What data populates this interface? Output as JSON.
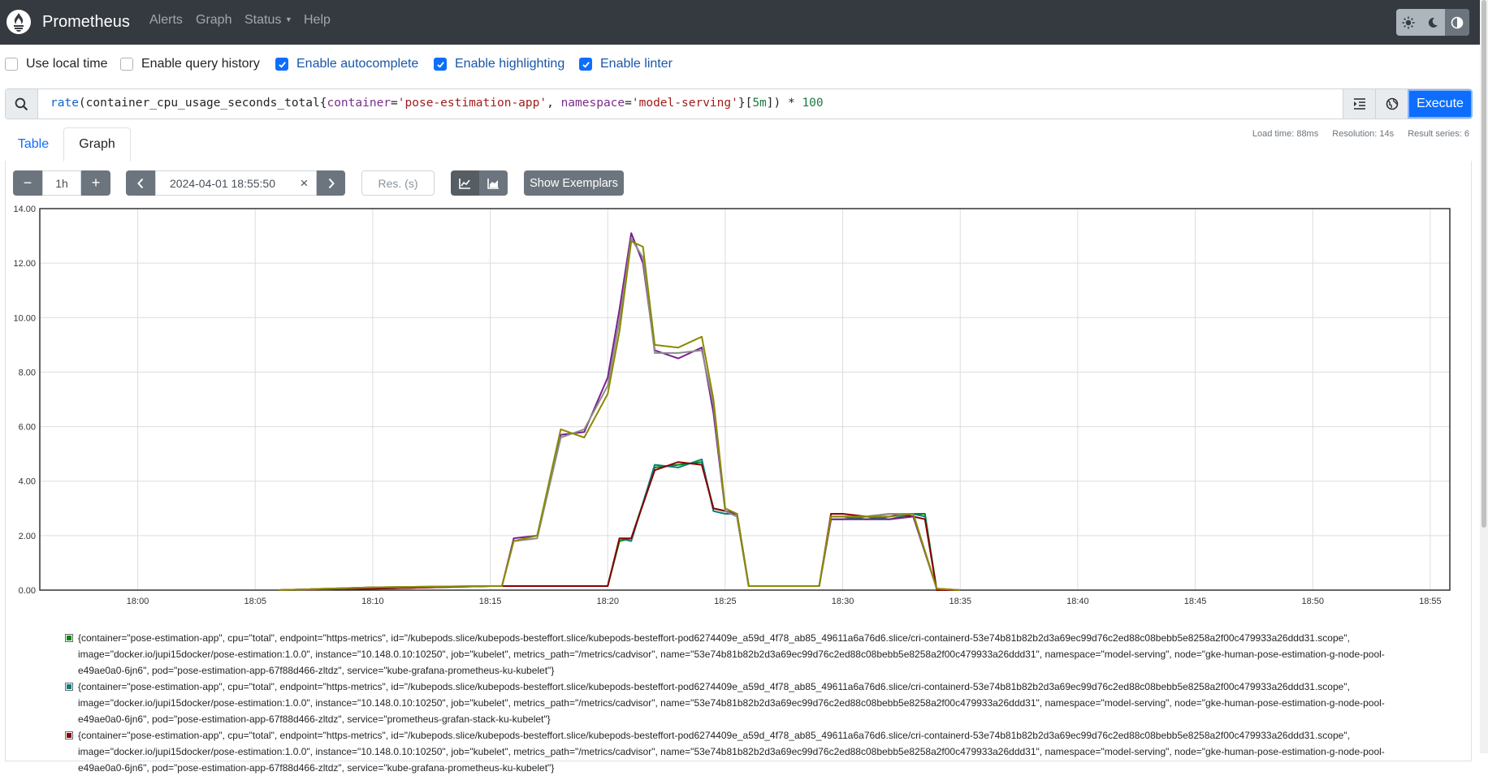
{
  "navbar": {
    "brand": "Prometheus",
    "links": [
      "Alerts",
      "Graph",
      "Status",
      "Help"
    ]
  },
  "options": {
    "local_time": "Use local time",
    "query_history": "Enable query history",
    "autocomplete": "Enable autocomplete",
    "highlighting": "Enable highlighting",
    "linter": "Enable linter",
    "checked": {
      "local_time": false,
      "query_history": false,
      "autocomplete": true,
      "highlighting": true,
      "linter": true
    }
  },
  "query": {
    "fn": "rate",
    "metric": "(container_cpu_usage_seconds_total{",
    "l1": "container",
    "v1": "'pose-estimation-app'",
    "sep": ", ",
    "l2": "namespace",
    "v2": "'model-serving'",
    "range_open": "}[",
    "range": "5m",
    "range_close": "]) * ",
    "mult": "100",
    "execute_label": "Execute"
  },
  "tabs": [
    "Table",
    "Graph"
  ],
  "stats": {
    "load": "Load time: 88ms",
    "resolution": "Resolution: 14s",
    "series": "Result series: 6"
  },
  "controls": {
    "minus": "−",
    "plus": "+",
    "range": "1h",
    "end_time": "2024-04-01 18:55:50",
    "clear": "×",
    "prev": "‹",
    "next": "›",
    "resolution_placeholder": "Res. (s)",
    "exemplars_label": "Show Exemplars"
  },
  "colors": {
    "navbar": "#343a40",
    "accent": "#0d6efd"
  },
  "chart_data": {
    "type": "line",
    "ylim": [
      0,
      14
    ],
    "xlim": [
      "17:55:50",
      "18:55:50"
    ],
    "yticks": [
      "0.00",
      "2.00",
      "4.00",
      "6.00",
      "8.00",
      "10.00",
      "12.00",
      "14.00"
    ],
    "xticks": [
      "18:00",
      "18:05",
      "18:10",
      "18:15",
      "18:20",
      "18:25",
      "18:30",
      "18:35",
      "18:40",
      "18:45",
      "18:50",
      "18:55"
    ],
    "grid": true,
    "legend_position": "bottom",
    "series": [
      {
        "color": "#00890c",
        "x": [
          "18:06",
          "18:10",
          "18:15",
          "18:16",
          "18:17",
          "18:18",
          "18:19",
          "18:20",
          "18:20:30",
          "18:21",
          "18:22",
          "18:23",
          "18:24",
          "18:24:30",
          "18:25",
          "18:25:30",
          "18:26",
          "18:28",
          "18:29",
          "18:29:30",
          "18:30",
          "18:31",
          "18:32",
          "18:33",
          "18:33:30",
          "18:34",
          "18:35"
        ],
        "y": [
          0,
          0.05,
          0.15,
          0.15,
          0.15,
          0.15,
          0.15,
          0.15,
          1.8,
          1.9,
          4.5,
          4.6,
          4.7,
          3.0,
          2.9,
          2.8,
          0.15,
          0.15,
          0.15,
          2.7,
          2.7,
          2.6,
          2.7,
          2.8,
          2.8,
          0,
          0
        ]
      },
      {
        "color": "#0d7d7d",
        "x": [
          "18:06",
          "18:10",
          "18:15",
          "18:16",
          "18:17",
          "18:18",
          "18:19",
          "18:20",
          "18:20:30",
          "18:21",
          "18:22",
          "18:23",
          "18:24",
          "18:24:30",
          "18:25",
          "18:25:30",
          "18:26",
          "18:28",
          "18:29",
          "18:29:30",
          "18:30",
          "18:31",
          "18:32",
          "18:33",
          "18:33:30",
          "18:34",
          "18:35"
        ],
        "y": [
          0,
          0.05,
          0.15,
          0.15,
          0.15,
          0.15,
          0.15,
          0.15,
          1.9,
          1.8,
          4.6,
          4.5,
          4.8,
          2.9,
          2.8,
          2.8,
          0.15,
          0.15,
          0.15,
          2.6,
          2.6,
          2.7,
          2.6,
          2.8,
          2.7,
          0,
          0
        ]
      },
      {
        "color": "#8b0000",
        "x": [
          "18:06",
          "18:10",
          "18:15",
          "18:16",
          "18:17",
          "18:18",
          "18:19",
          "18:20",
          "18:20:30",
          "18:21",
          "18:22",
          "18:23",
          "18:24",
          "18:24:30",
          "18:25",
          "18:25:30",
          "18:26",
          "18:28",
          "18:29",
          "18:29:30",
          "18:30",
          "18:31",
          "18:32",
          "18:33",
          "18:33:30",
          "18:34",
          "18:35"
        ],
        "y": [
          0,
          0.05,
          0.15,
          0.15,
          0.15,
          0.15,
          0.15,
          0.15,
          1.9,
          1.9,
          4.4,
          4.7,
          4.6,
          3.0,
          2.9,
          2.7,
          0.15,
          0.15,
          0.15,
          2.8,
          2.8,
          2.7,
          2.8,
          2.7,
          2.6,
          0,
          0
        ]
      },
      {
        "color": "#7a1e8e",
        "x": [
          "18:06",
          "18:10",
          "18:15",
          "18:15:30",
          "18:16",
          "18:17",
          "18:18",
          "18:19",
          "18:20",
          "18:20:30",
          "18:21",
          "18:21:30",
          "18:22",
          "18:23",
          "18:24",
          "18:24:30",
          "18:25",
          "18:25:30",
          "18:26",
          "18:28",
          "18:29",
          "18:29:30",
          "18:30",
          "18:31",
          "18:32",
          "18:33",
          "18:34",
          "18:35"
        ],
        "y": [
          0,
          0.1,
          0.15,
          0.15,
          1.9,
          2.0,
          5.7,
          5.8,
          7.8,
          10.3,
          13.1,
          12.0,
          8.8,
          8.5,
          8.9,
          6.5,
          2.9,
          2.8,
          0.15,
          0.15,
          0.15,
          2.6,
          2.6,
          2.6,
          2.6,
          2.7,
          0.05,
          0
        ]
      },
      {
        "color": "#8c8c8c",
        "x": [
          "18:06",
          "18:10",
          "18:15",
          "18:15:30",
          "18:16",
          "18:17",
          "18:18",
          "18:19",
          "18:20",
          "18:20:30",
          "18:21",
          "18:21:30",
          "18:22",
          "18:23",
          "18:24",
          "18:24:30",
          "18:25",
          "18:25:30",
          "18:26",
          "18:28",
          "18:29",
          "18:29:30",
          "18:30",
          "18:31",
          "18:32",
          "18:33",
          "18:34",
          "18:35"
        ],
        "y": [
          0,
          0.1,
          0.15,
          0.15,
          1.8,
          1.9,
          5.6,
          5.9,
          7.5,
          9.9,
          12.9,
          12.2,
          8.7,
          8.7,
          8.8,
          6.8,
          2.9,
          2.7,
          0.15,
          0.15,
          0.15,
          2.7,
          2.7,
          2.7,
          2.8,
          2.8,
          0.05,
          0
        ]
      },
      {
        "color": "#8a8a00",
        "x": [
          "18:06",
          "18:10",
          "18:15",
          "18:15:30",
          "18:16",
          "18:17",
          "18:18",
          "18:19",
          "18:20",
          "18:20:30",
          "18:21",
          "18:21:30",
          "18:22",
          "18:23",
          "18:24",
          "18:24:30",
          "18:25",
          "18:25:30",
          "18:26",
          "18:28",
          "18:29",
          "18:29:30",
          "18:30",
          "18:31",
          "18:32",
          "18:33",
          "18:34",
          "18:35"
        ],
        "y": [
          0,
          0.1,
          0.15,
          0.15,
          1.8,
          2.0,
          5.9,
          5.6,
          7.2,
          9.5,
          12.8,
          12.6,
          9.0,
          8.9,
          9.3,
          7.0,
          3.0,
          2.8,
          0.15,
          0.15,
          0.15,
          2.7,
          2.7,
          2.7,
          2.7,
          2.8,
          0.05,
          0
        ]
      }
    ]
  },
  "legend": [
    {
      "color": "#00890c",
      "text": "{container=\"pose-estimation-app\", cpu=\"total\", endpoint=\"https-metrics\", id=\"/kubepods.slice/kubepods-besteffort.slice/kubepods-besteffort-pod6274409e_a59d_4f78_ab85_49611a6a76d6.slice/cri-containerd-53e74b81b82b2d3a69ec99d76c2ed88c08bebb5e8258a2f00c479933a26ddd31.scope\", image=\"docker.io/jupi15docker/pose-estimation:1.0.0\", instance=\"10.148.0.10:10250\", job=\"kubelet\", metrics_path=\"/metrics/cadvisor\", name=\"53e74b81b82b2d3a69ec99d76c2ed88c08bebb5e8258a2f00c479933a26ddd31\", namespace=\"model-serving\", node=\"gke-human-pose-estimation-g-node-pool-e49ae0a0-6jn6\", pod=\"pose-estimation-app-67f88d466-zltdz\", service=\"kube-grafana-prometheus-ku-kubelet\"}"
    },
    {
      "color": "#0d7d7d",
      "text": "{container=\"pose-estimation-app\", cpu=\"total\", endpoint=\"https-metrics\", id=\"/kubepods.slice/kubepods-besteffort.slice/kubepods-besteffort-pod6274409e_a59d_4f78_ab85_49611a6a76d6.slice/cri-containerd-53e74b81b82b2d3a69ec99d76c2ed88c08bebb5e8258a2f00c479933a26ddd31.scope\", image=\"docker.io/jupi15docker/pose-estimation:1.0.0\", instance=\"10.148.0.10:10250\", job=\"kubelet\", metrics_path=\"/metrics/cadvisor\", name=\"53e74b81b82b2d3a69ec99d76c2ed88c08bebb5e8258a2f00c479933a26ddd31\", namespace=\"model-serving\", node=\"gke-human-pose-estimation-g-node-pool-e49ae0a0-6jn6\", pod=\"pose-estimation-app-67f88d466-zltdz\", service=\"prometheus-grafan-stack-ku-kubelet\"}"
    },
    {
      "color": "#8b0000",
      "text": "{container=\"pose-estimation-app\", cpu=\"total\", endpoint=\"https-metrics\", id=\"/kubepods.slice/kubepods-besteffort.slice/kubepods-besteffort-pod6274409e_a59d_4f78_ab85_49611a6a76d6.slice/cri-containerd-53e74b81b82b2d3a69ec99d76c2ed88c08bebb5e8258a2f00c479933a26ddd31.scope\", image=\"docker.io/jupi15docker/pose-estimation:1.0.0\", instance=\"10.148.0.10:10250\", job=\"kubelet\", metrics_path=\"/metrics/cadvisor\", name=\"53e74b81b82b2d3a69ec99d76c2ed88c08bebb5e8258a2f00c479933a26ddd31\", namespace=\"model-serving\", node=\"gke-human-pose-estimation-g-node-pool-e49ae0a0-6jn6\", pod=\"pose-estimation-app-67f88d466-zltdz\", service=\"kube-grafana-prometheus-ku-kubelet\"}"
    }
  ]
}
